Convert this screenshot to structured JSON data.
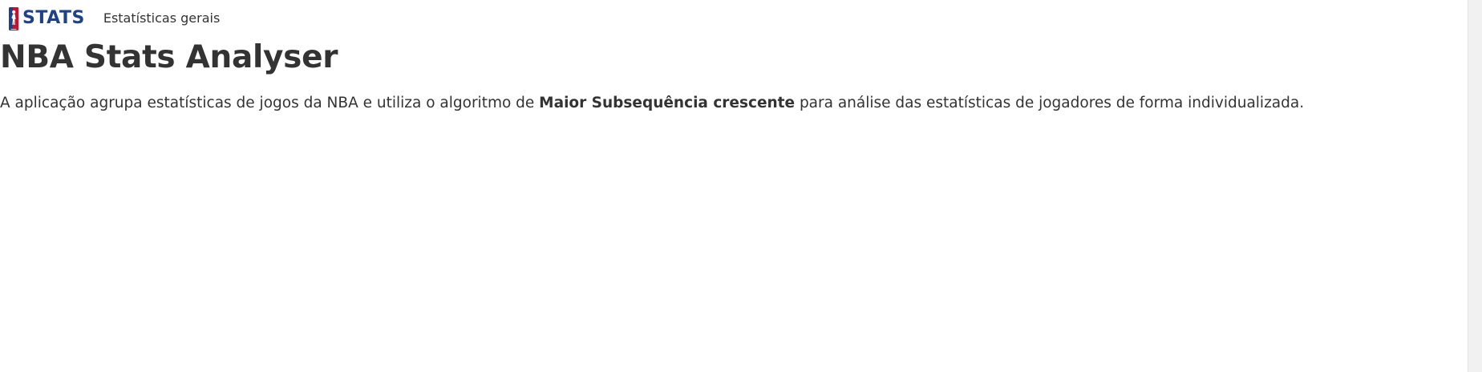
{
  "navbar": {
    "logo_text": "STATS",
    "links": [
      {
        "label": "Estatísticas gerais"
      }
    ]
  },
  "main": {
    "title": "NBA Stats Analyser",
    "intro": {
      "before": "A aplicação agrupa estatísticas de jogos da NBA e utiliza o algoritmo de ",
      "highlight": "Maior Subsequência crescente",
      "after": " para análise das estatísticas de jogadores de forma individualizada."
    }
  },
  "colors": {
    "brand_blue": "#1d428a",
    "brand_red": "#c8102e",
    "text": "#333333"
  },
  "icons": {
    "logo": "nba-logo-icon"
  }
}
